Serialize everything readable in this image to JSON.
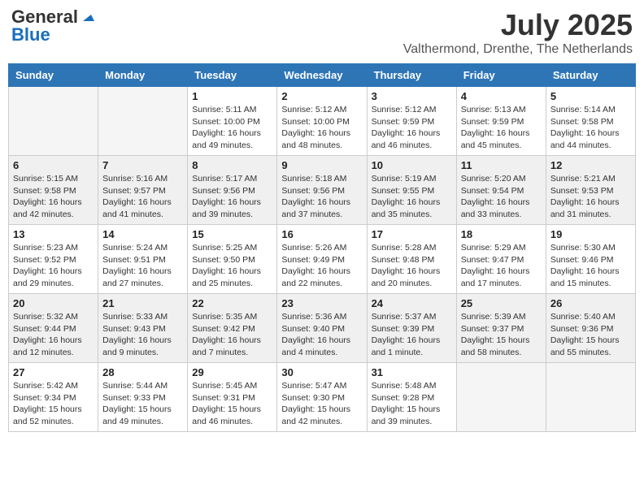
{
  "header": {
    "logo_general": "General",
    "logo_blue": "Blue",
    "month_year": "July 2025",
    "location": "Valthermond, Drenthe, The Netherlands"
  },
  "days_of_week": [
    "Sunday",
    "Monday",
    "Tuesday",
    "Wednesday",
    "Thursday",
    "Friday",
    "Saturday"
  ],
  "weeks": [
    [
      {
        "day": "",
        "info": ""
      },
      {
        "day": "",
        "info": ""
      },
      {
        "day": "1",
        "info": "Sunrise: 5:11 AM\nSunset: 10:00 PM\nDaylight: 16 hours and 49 minutes."
      },
      {
        "day": "2",
        "info": "Sunrise: 5:12 AM\nSunset: 10:00 PM\nDaylight: 16 hours and 48 minutes."
      },
      {
        "day": "3",
        "info": "Sunrise: 5:12 AM\nSunset: 9:59 PM\nDaylight: 16 hours and 46 minutes."
      },
      {
        "day": "4",
        "info": "Sunrise: 5:13 AM\nSunset: 9:59 PM\nDaylight: 16 hours and 45 minutes."
      },
      {
        "day": "5",
        "info": "Sunrise: 5:14 AM\nSunset: 9:58 PM\nDaylight: 16 hours and 44 minutes."
      }
    ],
    [
      {
        "day": "6",
        "info": "Sunrise: 5:15 AM\nSunset: 9:58 PM\nDaylight: 16 hours and 42 minutes."
      },
      {
        "day": "7",
        "info": "Sunrise: 5:16 AM\nSunset: 9:57 PM\nDaylight: 16 hours and 41 minutes."
      },
      {
        "day": "8",
        "info": "Sunrise: 5:17 AM\nSunset: 9:56 PM\nDaylight: 16 hours and 39 minutes."
      },
      {
        "day": "9",
        "info": "Sunrise: 5:18 AM\nSunset: 9:56 PM\nDaylight: 16 hours and 37 minutes."
      },
      {
        "day": "10",
        "info": "Sunrise: 5:19 AM\nSunset: 9:55 PM\nDaylight: 16 hours and 35 minutes."
      },
      {
        "day": "11",
        "info": "Sunrise: 5:20 AM\nSunset: 9:54 PM\nDaylight: 16 hours and 33 minutes."
      },
      {
        "day": "12",
        "info": "Sunrise: 5:21 AM\nSunset: 9:53 PM\nDaylight: 16 hours and 31 minutes."
      }
    ],
    [
      {
        "day": "13",
        "info": "Sunrise: 5:23 AM\nSunset: 9:52 PM\nDaylight: 16 hours and 29 minutes."
      },
      {
        "day": "14",
        "info": "Sunrise: 5:24 AM\nSunset: 9:51 PM\nDaylight: 16 hours and 27 minutes."
      },
      {
        "day": "15",
        "info": "Sunrise: 5:25 AM\nSunset: 9:50 PM\nDaylight: 16 hours and 25 minutes."
      },
      {
        "day": "16",
        "info": "Sunrise: 5:26 AM\nSunset: 9:49 PM\nDaylight: 16 hours and 22 minutes."
      },
      {
        "day": "17",
        "info": "Sunrise: 5:28 AM\nSunset: 9:48 PM\nDaylight: 16 hours and 20 minutes."
      },
      {
        "day": "18",
        "info": "Sunrise: 5:29 AM\nSunset: 9:47 PM\nDaylight: 16 hours and 17 minutes."
      },
      {
        "day": "19",
        "info": "Sunrise: 5:30 AM\nSunset: 9:46 PM\nDaylight: 16 hours and 15 minutes."
      }
    ],
    [
      {
        "day": "20",
        "info": "Sunrise: 5:32 AM\nSunset: 9:44 PM\nDaylight: 16 hours and 12 minutes."
      },
      {
        "day": "21",
        "info": "Sunrise: 5:33 AM\nSunset: 9:43 PM\nDaylight: 16 hours and 9 minutes."
      },
      {
        "day": "22",
        "info": "Sunrise: 5:35 AM\nSunset: 9:42 PM\nDaylight: 16 hours and 7 minutes."
      },
      {
        "day": "23",
        "info": "Sunrise: 5:36 AM\nSunset: 9:40 PM\nDaylight: 16 hours and 4 minutes."
      },
      {
        "day": "24",
        "info": "Sunrise: 5:37 AM\nSunset: 9:39 PM\nDaylight: 16 hours and 1 minute."
      },
      {
        "day": "25",
        "info": "Sunrise: 5:39 AM\nSunset: 9:37 PM\nDaylight: 15 hours and 58 minutes."
      },
      {
        "day": "26",
        "info": "Sunrise: 5:40 AM\nSunset: 9:36 PM\nDaylight: 15 hours and 55 minutes."
      }
    ],
    [
      {
        "day": "27",
        "info": "Sunrise: 5:42 AM\nSunset: 9:34 PM\nDaylight: 15 hours and 52 minutes."
      },
      {
        "day": "28",
        "info": "Sunrise: 5:44 AM\nSunset: 9:33 PM\nDaylight: 15 hours and 49 minutes."
      },
      {
        "day": "29",
        "info": "Sunrise: 5:45 AM\nSunset: 9:31 PM\nDaylight: 15 hours and 46 minutes."
      },
      {
        "day": "30",
        "info": "Sunrise: 5:47 AM\nSunset: 9:30 PM\nDaylight: 15 hours and 42 minutes."
      },
      {
        "day": "31",
        "info": "Sunrise: 5:48 AM\nSunset: 9:28 PM\nDaylight: 15 hours and 39 minutes."
      },
      {
        "day": "",
        "info": ""
      },
      {
        "day": "",
        "info": ""
      }
    ]
  ]
}
